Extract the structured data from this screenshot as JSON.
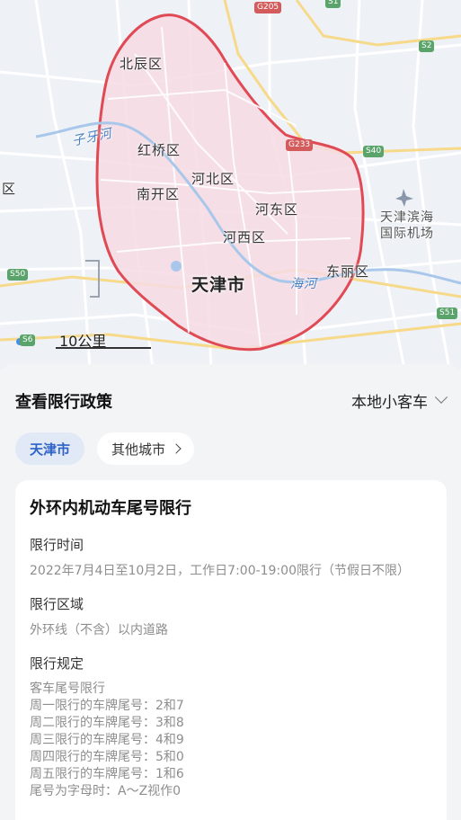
{
  "map": {
    "districts": {
      "beichen": "北辰区",
      "hongqiao": "红桥区",
      "hebei": "河北区",
      "nankai": "南开区",
      "hedong": "河东区",
      "hexi": "河西区",
      "dongli": "东丽区",
      "edge_left": "区"
    },
    "city": "天津市",
    "airport": "天津滨海\n国际机场",
    "rivers": {
      "ziya": "子牙河",
      "hai": "海河"
    },
    "road_badges": {
      "g205": "G205",
      "s1": "S1",
      "s2": "S2",
      "s40": "S40",
      "g233": "G233",
      "s50": "S50",
      "s6": "S6",
      "s51": "S51"
    },
    "scale": "10公里",
    "colors": {
      "ring_road": "#e04a55",
      "zone_fill": "#f6dbe3"
    }
  },
  "sheet": {
    "title": "查看限行政策",
    "vehicle_type": "本地小客车",
    "tabs": {
      "current": "天津市",
      "other": "其他城市"
    }
  },
  "card": {
    "title": "外环内机动车尾号限行",
    "time": {
      "label": "限行时间",
      "value": "2022年7月4日至10月2日，工作日7:00-19:00限行（节假日不限）"
    },
    "area": {
      "label": "限行区域",
      "value": "外环线（不含）以内道路"
    },
    "rules": {
      "label": "限行规定",
      "lines": [
        "客车尾号限行",
        "周一限行的车牌尾号：2和7",
        "周二限行的车牌尾号：3和8",
        "周三限行的车牌尾号：4和9",
        "周四限行的车牌尾号：5和0",
        "周五限行的车牌尾号：1和6",
        "尾号为字母时：A～Z视作0"
      ]
    }
  }
}
